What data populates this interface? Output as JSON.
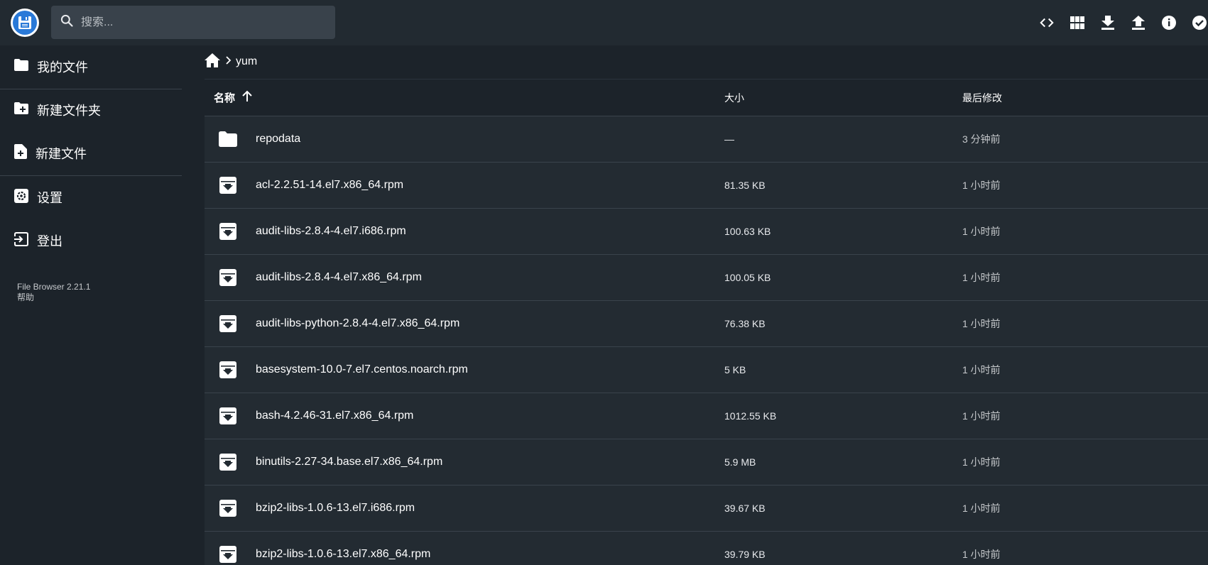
{
  "header": {
    "search_placeholder": "搜索...",
    "actions": [
      "code-icon",
      "grid-view-icon",
      "download-icon",
      "upload-icon",
      "info-icon",
      "select-check-icon"
    ]
  },
  "sidebar": {
    "items": [
      {
        "label": "我的文件",
        "icon": "folder-icon"
      },
      {
        "label": "新建文件夹",
        "icon": "new-folder-icon"
      },
      {
        "label": "新建文件",
        "icon": "new-file-icon"
      },
      {
        "label": "设置",
        "icon": "settings-icon"
      },
      {
        "label": "登出",
        "icon": "logout-icon"
      }
    ],
    "version": "File Browser 2.21.1",
    "help": "帮助"
  },
  "breadcrumb": {
    "current": "yum"
  },
  "table": {
    "headers": {
      "name": "名称",
      "size": "大小",
      "modified": "最后修改"
    },
    "rows": [
      {
        "type": "folder",
        "name": "repodata",
        "size": "—",
        "modified": "3 分钟前"
      },
      {
        "type": "file",
        "name": "acl-2.2.51-14.el7.x86_64.rpm",
        "size": "81.35 KB",
        "modified": "1 小时前"
      },
      {
        "type": "file",
        "name": "audit-libs-2.8.4-4.el7.i686.rpm",
        "size": "100.63 KB",
        "modified": "1 小时前"
      },
      {
        "type": "file",
        "name": "audit-libs-2.8.4-4.el7.x86_64.rpm",
        "size": "100.05 KB",
        "modified": "1 小时前"
      },
      {
        "type": "file",
        "name": "audit-libs-python-2.8.4-4.el7.x86_64.rpm",
        "size": "76.38 KB",
        "modified": "1 小时前"
      },
      {
        "type": "file",
        "name": "basesystem-10.0-7.el7.centos.noarch.rpm",
        "size": "5 KB",
        "modified": "1 小时前"
      },
      {
        "type": "file",
        "name": "bash-4.2.46-31.el7.x86_64.rpm",
        "size": "1012.55 KB",
        "modified": "1 小时前"
      },
      {
        "type": "file",
        "name": "binutils-2.27-34.base.el7.x86_64.rpm",
        "size": "5.9 MB",
        "modified": "1 小时前"
      },
      {
        "type": "file",
        "name": "bzip2-libs-1.0.6-13.el7.i686.rpm",
        "size": "39.67 KB",
        "modified": "1 小时前"
      },
      {
        "type": "file",
        "name": "bzip2-libs-1.0.6-13.el7.x86_64.rpm",
        "size": "39.79 KB",
        "modified": "1 小时前"
      }
    ]
  }
}
